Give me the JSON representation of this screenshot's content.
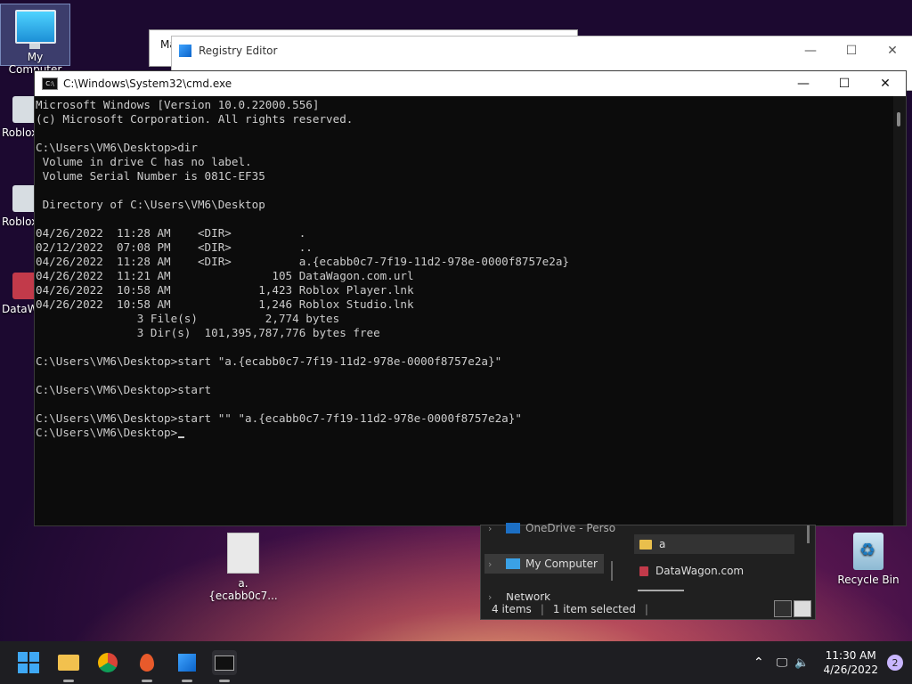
{
  "desktop": {
    "icons": {
      "my_computer": "My Computer",
      "roblox_1": "Roblox",
      "roblox_2": "Roblox",
      "datawagon": "DataW",
      "file_a": "a.{ecabb0c7...",
      "recycle_bin": "Recycle Bin"
    }
  },
  "background_windows": {
    "maw_title": "Ma",
    "regedit_title": "Registry Editor"
  },
  "cmd": {
    "title": "C:\\Windows\\System32\\cmd.exe",
    "icon_text": "C:\\",
    "lines": [
      "Microsoft Windows [Version 10.0.22000.556]",
      "(c) Microsoft Corporation. All rights reserved.",
      "",
      "C:\\Users\\VM6\\Desktop>dir",
      " Volume in drive C has no label.",
      " Volume Serial Number is 081C-EF35",
      "",
      " Directory of C:\\Users\\VM6\\Desktop",
      "",
      "04/26/2022  11:28 AM    <DIR>          .",
      "02/12/2022  07:08 PM    <DIR>          ..",
      "04/26/2022  11:28 AM    <DIR>          a.{ecabb0c7-7f19-11d2-978e-0000f8757e2a}",
      "04/26/2022  11:21 AM               105 DataWagon.com.url",
      "04/26/2022  10:58 AM             1,423 Roblox Player.lnk",
      "04/26/2022  10:58 AM             1,246 Roblox Studio.lnk",
      "               3 File(s)          2,774 bytes",
      "               3 Dir(s)  101,395,787,776 bytes free",
      "",
      "C:\\Users\\VM6\\Desktop>start \"a.{ecabb0c7-7f19-11d2-978e-0000f8757e2a}\"",
      "",
      "C:\\Users\\VM6\\Desktop>start",
      "",
      "C:\\Users\\VM6\\Desktop>start \"\" \"a.{ecabb0c7-7f19-11d2-978e-0000f8757e2a}\"",
      ""
    ],
    "prompt": "C:\\Users\\VM6\\Desktop>"
  },
  "explorer": {
    "nav": {
      "onedrive": "OneDrive - Perso",
      "my_computer": "My Computer",
      "network": "Network"
    },
    "files": {
      "a": "a",
      "datawagon": "DataWagon.com"
    },
    "status": {
      "items": "4 items",
      "selected": "1 item selected"
    }
  },
  "taskbar": {
    "time": "11:30 AM",
    "date": "4/26/2022",
    "notifications": "2"
  },
  "colors": {
    "console_bg": "#0c0c0c",
    "console_text": "#cccccc",
    "accent": "#3fa8f5"
  }
}
